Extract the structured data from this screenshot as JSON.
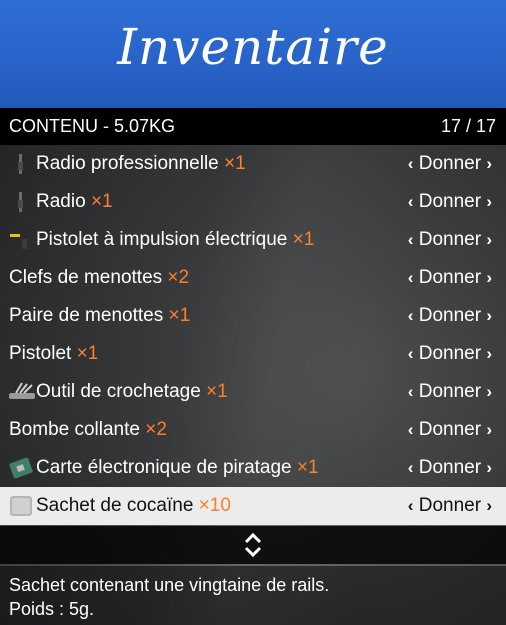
{
  "header": {
    "title": "Inventaire"
  },
  "subtitle": {
    "left": "CONTENU - 5.07KG",
    "right": "17 / 17"
  },
  "action": {
    "label": "Donner",
    "left_chevron": "‹",
    "right_chevron": "›"
  },
  "items": [
    {
      "name": "Radio professionnelle",
      "qty": "×1",
      "icon": "radio-icon"
    },
    {
      "name": "Radio",
      "qty": "×1",
      "icon": "radio-icon"
    },
    {
      "name": "Pistolet à impulsion électrique",
      "qty": "×1",
      "icon": "taser-icon"
    },
    {
      "name": "Clefs de menottes",
      "qty": "×2",
      "icon": ""
    },
    {
      "name": "Paire de menottes",
      "qty": "×1",
      "icon": ""
    },
    {
      "name": "Pistolet",
      "qty": "×1",
      "icon": ""
    },
    {
      "name": "Outil de crochetage",
      "qty": "×1",
      "icon": "lockpick-icon"
    },
    {
      "name": "Bombe collante",
      "qty": "×2",
      "icon": ""
    },
    {
      "name": "Carte électronique de piratage",
      "qty": "×1",
      "icon": "circuit-board-icon"
    },
    {
      "name": "Sachet de cocaïne",
      "qty": "×10",
      "icon": "bag-icon",
      "selected": true
    }
  ],
  "description": {
    "line1": "Sachet contenant une vingtaine de rails.",
    "line2": "Poids : 5g."
  },
  "colors": {
    "banner": "#2863c8",
    "quantity": "#ff7f2a",
    "selected_row": "#ececec"
  }
}
